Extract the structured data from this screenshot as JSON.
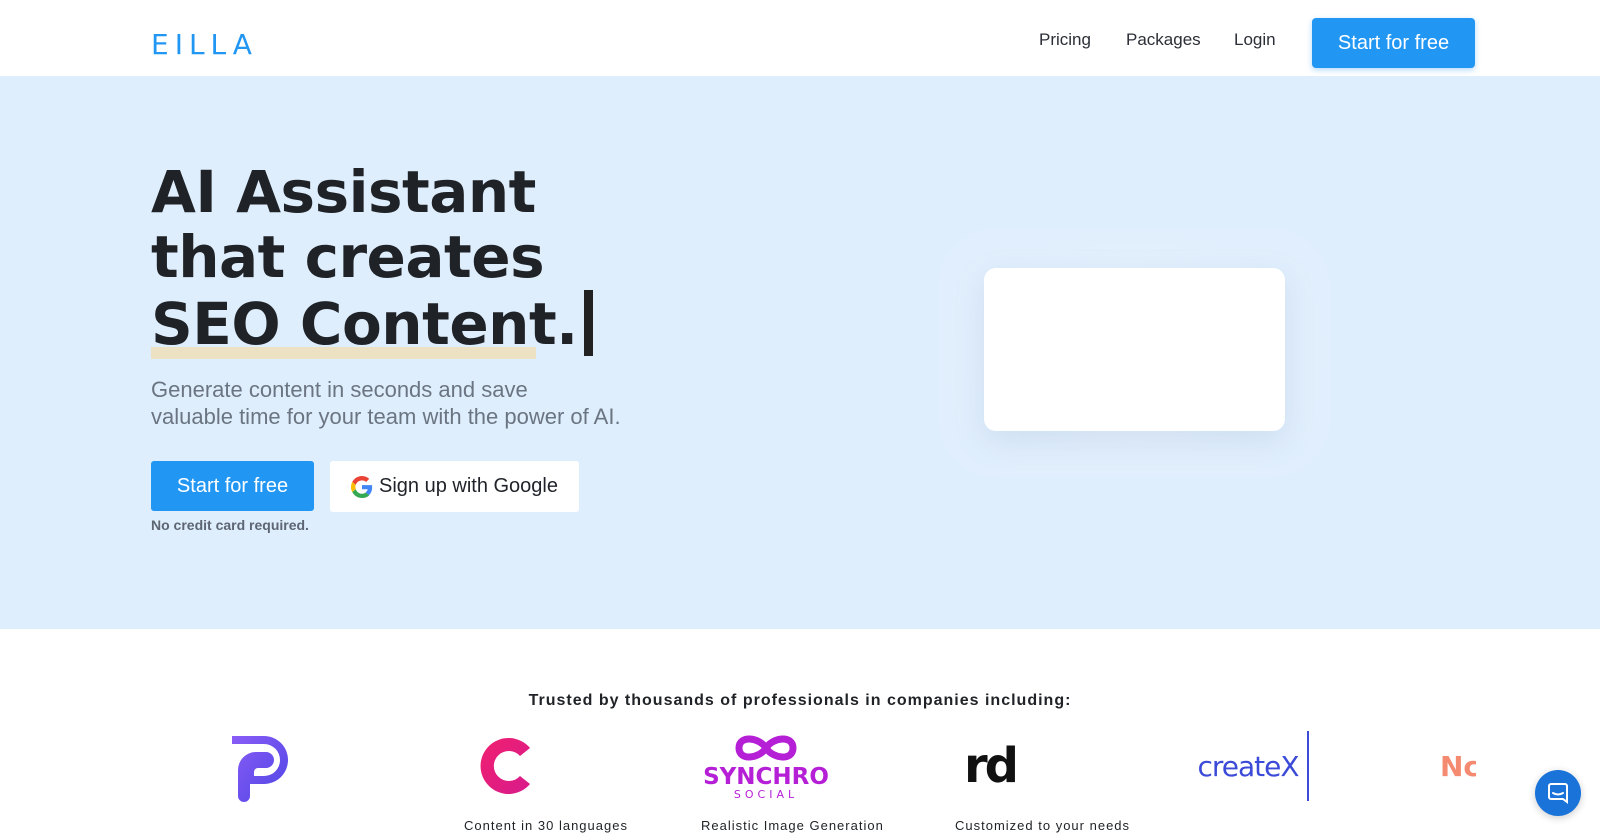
{
  "nav": {
    "logo_text": "EILLA",
    "links": [
      {
        "label": "Pricing"
      },
      {
        "label": "Packages"
      },
      {
        "label": "Login"
      }
    ],
    "cta_label": "Start for free"
  },
  "hero": {
    "headline_line1": "AI Assistant",
    "headline_line2": "that creates",
    "headline_line3": "SEO Content.",
    "subtitle_line1": "Generate content in seconds and save",
    "subtitle_line2": "valuable time for your team with the power of AI.",
    "primary_button": "Start for free",
    "google_button": "Sign up with Google",
    "note": "No credit card required."
  },
  "trusted": {
    "heading": "Trusted by thousands of professionals in companies including:",
    "logos": [
      {
        "name": "p-logo",
        "color": "#6a4cf5"
      },
      {
        "name": "c-logo",
        "color": "#e8197d"
      },
      {
        "name": "synchro-social-logo",
        "text": "SYNCHRO",
        "subtext": "SOCIAL",
        "color": "#b51fd6"
      },
      {
        "name": "rd-logo",
        "text": "rd",
        "color": "#111111"
      },
      {
        "name": "createx-logo",
        "text": "createX",
        "color": "#3b4bd8"
      },
      {
        "name": "partial-logo",
        "text": "Nc",
        "color": "#f48a70"
      }
    ],
    "features": [
      "Content in 30 languages",
      "Realistic Image Generation",
      "Customized to your needs"
    ]
  },
  "colors": {
    "accent": "#2196f3",
    "hero_bg": "#dfeefd",
    "highlight": "#ece2c3"
  }
}
